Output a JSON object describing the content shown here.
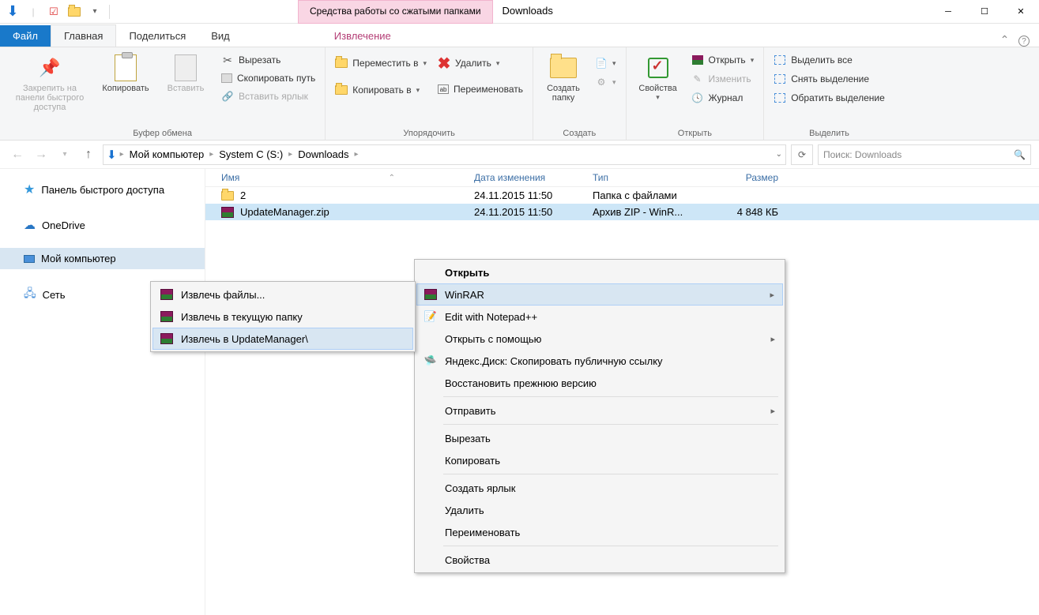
{
  "titlebar": {
    "tool_tab": "Средства работы со сжатыми папками",
    "window_title": "Downloads"
  },
  "ribbon_tabs": {
    "file": "Файл",
    "home": "Главная",
    "share": "Поделиться",
    "view": "Вид",
    "extract": "Извлечение"
  },
  "ribbon": {
    "clipboard": {
      "pin": "Закрепить на панели быстрого доступа",
      "copy": "Копировать",
      "paste": "Вставить",
      "cut": "Вырезать",
      "copy_path": "Скопировать путь",
      "paste_shortcut": "Вставить ярлык",
      "group": "Буфер обмена"
    },
    "organize": {
      "move_to": "Переместить в",
      "copy_to": "Копировать в",
      "delete": "Удалить",
      "rename": "Переименовать",
      "group": "Упорядочить"
    },
    "create": {
      "new_folder": "Создать папку",
      "group": "Создать"
    },
    "open": {
      "properties": "Свойства",
      "open": "Открыть",
      "edit": "Изменить",
      "history": "Журнал",
      "group": "Открыть"
    },
    "select": {
      "select_all": "Выделить все",
      "select_none": "Снять выделение",
      "invert": "Обратить выделение",
      "group": "Выделить"
    }
  },
  "breadcrumb": {
    "seg1": "Мой компьютер",
    "seg2": "System C (S:)",
    "seg3": "Downloads"
  },
  "search_placeholder": "Поиск: Downloads",
  "sidebar": {
    "quick": "Панель быстрого доступа",
    "onedrive": "OneDrive",
    "mycomp": "Мой компьютер",
    "network": "Сеть"
  },
  "columns": {
    "name": "Имя",
    "date": "Дата изменения",
    "type": "Тип",
    "size": "Размер"
  },
  "rows": [
    {
      "name": "2",
      "date": "24.11.2015 11:50",
      "type": "Папка с файлами",
      "size": ""
    },
    {
      "name": "UpdateManager.zip",
      "date": "24.11.2015 11:50",
      "type": "Архив ZIP - WinR...",
      "size": "4 848 КБ"
    }
  ],
  "submenu": {
    "extract_files": "Извлечь файлы...",
    "extract_here": "Извлечь в текущую папку",
    "extract_to": "Извлечь в UpdateManager\\"
  },
  "ctx": {
    "open": "Открыть",
    "winrar": "WinRAR",
    "notepad": "Edit with Notepad++",
    "open_with": "Открыть с помощью",
    "yandex": "Яндекс.Диск: Скопировать публичную ссылку",
    "restore": "Восстановить прежнюю версию",
    "send": "Отправить",
    "cut": "Вырезать",
    "copy": "Копировать",
    "shortcut": "Создать ярлык",
    "delete": "Удалить",
    "rename": "Переименовать",
    "properties": "Свойства"
  }
}
